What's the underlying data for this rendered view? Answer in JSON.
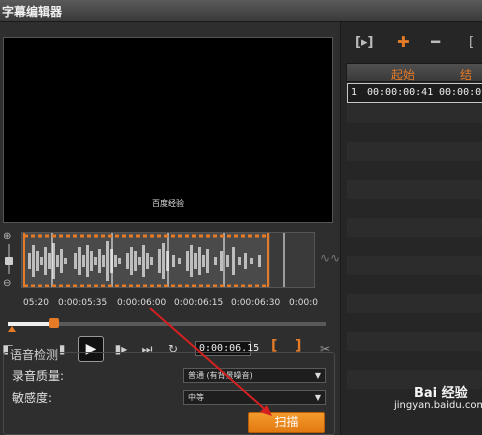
{
  "window": {
    "title": "字幕编辑器"
  },
  "preview": {
    "subtitle_text": "百度经验"
  },
  "timeline": {
    "timecodes": [
      "05:20",
      "0:00:05:35",
      "0:00:06:00",
      "0:00:06:15",
      "0:00:06:30",
      "0:00:0"
    ],
    "scrub_position": 0.145
  },
  "transport": {
    "current_time": "0:00:06.15",
    "mark_in": "[",
    "mark_out": "]"
  },
  "speech_detection": {
    "group_title": "语音检测",
    "quality_label": "录音质量:",
    "quality_value": "普通 (有背景噪音)",
    "sensitivity_label": "敏感度:",
    "sensitivity_value": "中等",
    "scan_label": "扫描"
  },
  "subtitle_list": {
    "col_start": "起始",
    "col_end": "结束",
    "rows": [
      {
        "index": "1",
        "start": "00:00:00:41",
        "end": "00:00:0"
      }
    ]
  },
  "watermark": {
    "line1": "Bai 经验",
    "line2": "jingyan.baidu.com"
  },
  "colors": {
    "accent": "#e57b26",
    "panel": "#2e2e2e",
    "annotation_arrow": "#d42020"
  }
}
